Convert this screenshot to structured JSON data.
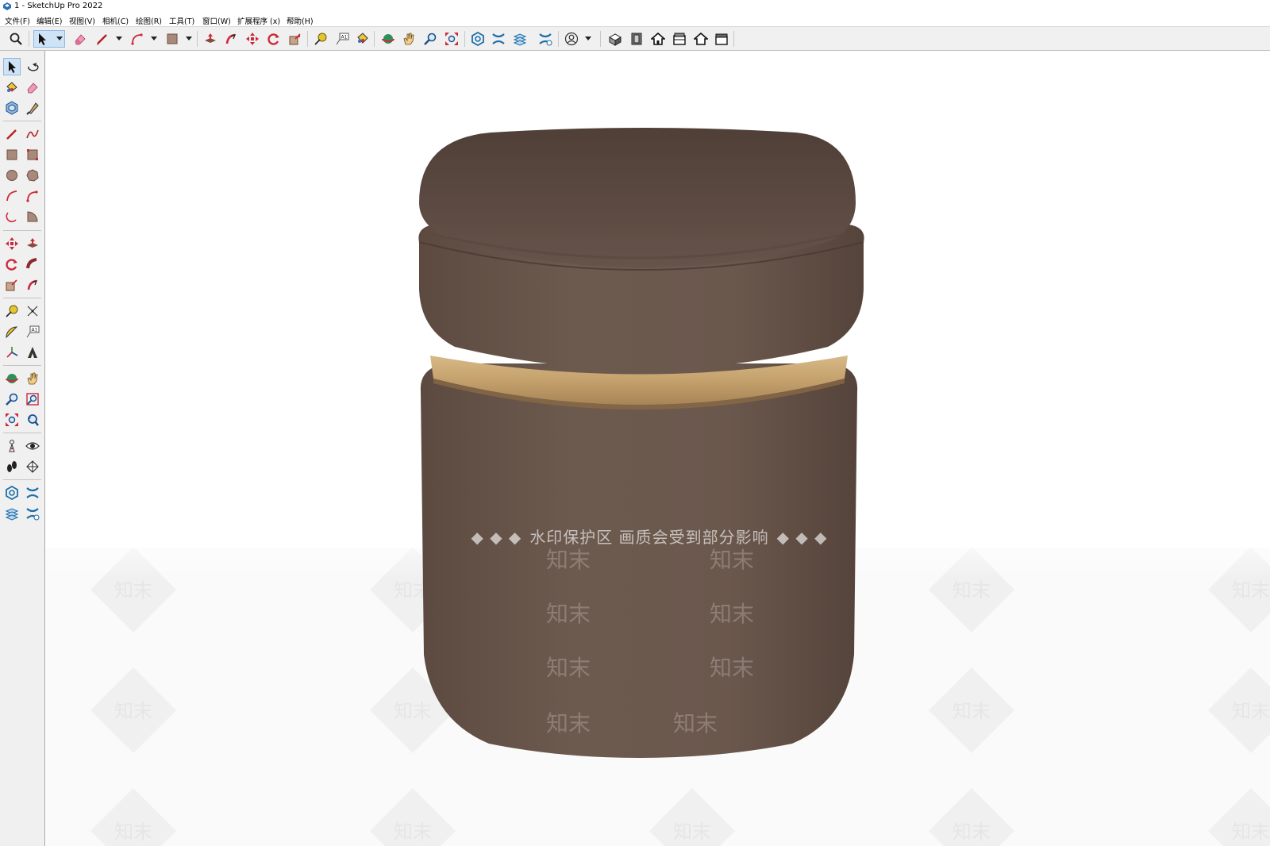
{
  "window": {
    "title": "1 - SketchUp Pro 2022"
  },
  "menu": [
    "文件(F)",
    "编辑(E)",
    "视图(V)",
    "相机(C)",
    "绘图(R)",
    "工具(T)",
    "窗口(W)",
    "扩展程序 (x)",
    "帮助(H)"
  ],
  "toolbar": {
    "icons": [
      "search-icon",
      "select-icon",
      "eraser-icon",
      "line-icon",
      "arc-icon",
      "rectangle-icon",
      "push-pull-icon",
      "follow-me-icon",
      "move-icon",
      "rotate-icon",
      "scale-icon",
      "tape-measure-icon",
      "text-icon",
      "paint-bucket-icon",
      "orbit-icon",
      "pan-icon",
      "zoom-icon",
      "zoom-extents-icon",
      "warehouse-icon",
      "extension-warehouse-icon",
      "layout-icon",
      "extension-manager-icon",
      "account-icon",
      "iso-view-icon",
      "top-view-icon",
      "front-view-icon",
      "right-view-icon",
      "back-view-icon",
      "left-view-icon"
    ]
  },
  "left_toolbar": {
    "icons": [
      "select-icon",
      "make-component-icon",
      "paint-bucket-icon",
      "eraser-icon",
      "tag-icon",
      "sample-paint-icon",
      "line-icon",
      "freehand-icon",
      "rectangle-icon",
      "rotated-rectangle-icon",
      "circle-icon",
      "polygon-icon",
      "arc-icon",
      "2point-arc-icon",
      "3point-arc-icon",
      "pie-icon",
      "move-icon",
      "push-pull-icon",
      "rotate-icon",
      "follow-me-icon",
      "scale-icon",
      "offset-icon",
      "tape-measure-icon",
      "dimension-icon",
      "protractor-icon",
      "text-icon",
      "axes-icon",
      "3d-text-icon",
      "orbit-icon",
      "pan-icon",
      "zoom-icon",
      "zoom-window-icon",
      "zoom-extents-icon",
      "previous-view-icon",
      "position-camera-icon",
      "look-around-icon",
      "walk-icon",
      "section-plane-icon",
      "warehouse-icon",
      "extension-warehouse-icon",
      "layout-icon",
      "extension-manager-icon"
    ]
  },
  "watermark": {
    "banner": "水印保护区  画质会受到部分影响",
    "diamond_mark": "◆ ◆ ◆",
    "logo_text": "知末"
  },
  "colors": {
    "stool_fabric": "#6a564b",
    "stool_shadow": "#4a3a33",
    "wood_band": "#c8a572",
    "toolbar_bg": "#f0f0f0",
    "selection": "#cfe3f7"
  }
}
